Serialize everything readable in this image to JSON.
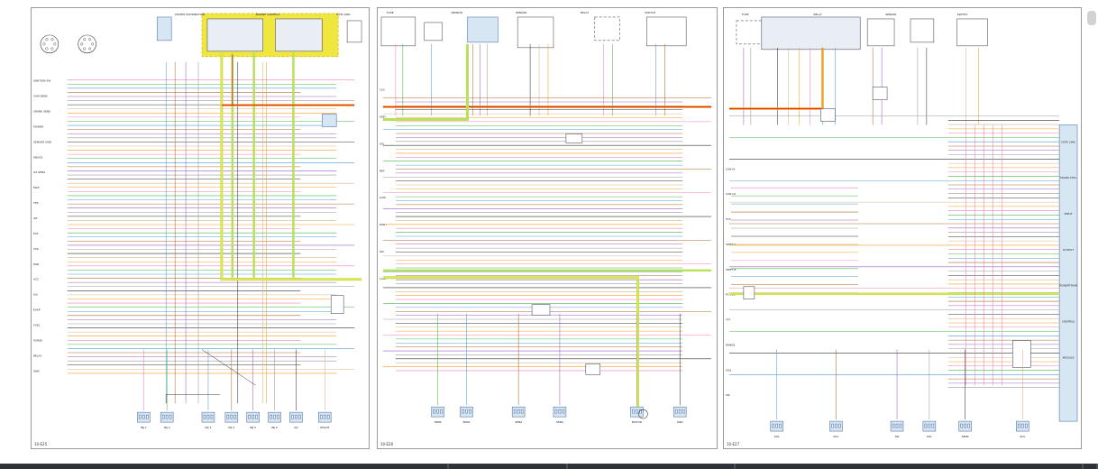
{
  "viewer": {
    "background": "#ffffff",
    "bar_color": "#2f3338"
  },
  "colors": {
    "yellow_highlight": "#f0e640",
    "green_highlight": "#b8e05a",
    "orange_wire": "#f0a020",
    "pink": "#f07fbf",
    "green": "#46b946",
    "blue": "#4f9bd6",
    "brown": "#b06a2e",
    "purple": "#9c5fc6",
    "gray": "#9a9a9a",
    "dark": "#333333",
    "tan": "#d2b48c",
    "connector_fill": "#d7e6f3"
  },
  "pages": [
    {
      "id": "page1",
      "code": "10-E25",
      "left_labels": [
        "IGNITION SW",
        "CAM SENS",
        "CRANK SENS",
        "POWER",
        "SENSOR GND",
        "KNOCK",
        "O2 SENS",
        "MAP",
        "TPS",
        "IAT",
        "ECT",
        "VSS",
        "EGR",
        "ACC",
        "A/C",
        "EVAP",
        "FUEL",
        "PURGE",
        "RELAY",
        "GND"
      ],
      "header_labels": [
        "POWER DISTRIBUTION",
        "ENGINE CONTROL",
        "DATA LINK"
      ],
      "bottom_labels": [
        "INJ 1",
        "INJ 2",
        "INJ 3",
        "INJ 4",
        "INJ 5",
        "INJ 6",
        "IAC",
        "SPLICE"
      ]
    },
    {
      "id": "page2",
      "code": "10-E26",
      "left_labels": [
        "12V",
        "GND",
        "SIG",
        "REF",
        "LOW",
        "HIGH",
        "SW",
        "LAMP"
      ],
      "header_labels": [
        "FUSE",
        "SENSOR",
        "SENSOR",
        "RELAY",
        "SWITCH"
      ],
      "bottom_labels": [
        "SENS",
        "SENS",
        "SENS",
        "SENS",
        "MOTOR",
        "GND"
      ]
    },
    {
      "id": "page3",
      "code": "10-E27",
      "left_labels": [
        "CAN HI",
        "CAN LO",
        "TCC",
        "SHIFT A",
        "SHIFT B",
        "PC SOL",
        "TFT",
        "RANGE",
        "OSS",
        "ISS"
      ],
      "right_labels": [
        "DATA LINK",
        "TRANS CTRL",
        "INPUT",
        "OUTPUT",
        "POWERTRAIN",
        "CONTROL",
        "MODULE"
      ],
      "header_labels": [
        "FUSE",
        "RELAY",
        "SENSOR",
        "SWITCH"
      ],
      "bottom_labels": [
        "SOL",
        "SOL",
        "SW",
        "SOL",
        "SENS",
        "SOL"
      ]
    }
  ],
  "bottom_bar": {
    "segments": [
      498,
      132,
      186,
      386,
      16
    ]
  }
}
